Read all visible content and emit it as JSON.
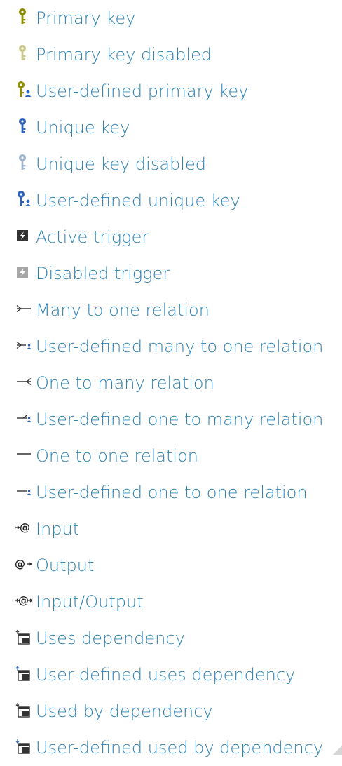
{
  "items": [
    {
      "label": "Primary key",
      "icon": "primary-key-icon"
    },
    {
      "label": "Primary key disabled",
      "icon": "primary-key-disabled-icon"
    },
    {
      "label": "User-defined primary key",
      "icon": "user-defined-primary-key-icon"
    },
    {
      "label": "Unique key",
      "icon": "unique-key-icon"
    },
    {
      "label": "Unique key disabled",
      "icon": "unique-key-disabled-icon"
    },
    {
      "label": "User-defined unique key",
      "icon": "user-defined-unique-key-icon"
    },
    {
      "label": "Active trigger",
      "icon": "active-trigger-icon"
    },
    {
      "label": "Disabled trigger",
      "icon": "disabled-trigger-icon"
    },
    {
      "label": "Many to one relation",
      "icon": "many-to-one-relation-icon"
    },
    {
      "label": "User-defined many to one relation",
      "icon": "user-defined-many-to-one-relation-icon"
    },
    {
      "label": "One to many relation",
      "icon": "one-to-many-relation-icon"
    },
    {
      "label": "User-defined one to many relation",
      "icon": "user-defined-one-to-many-relation-icon"
    },
    {
      "label": "One to one relation",
      "icon": "one-to-one-relation-icon"
    },
    {
      "label": "User-defined one to one relation",
      "icon": "user-defined-one-to-one-relation-icon"
    },
    {
      "label": "Input",
      "icon": "input-icon"
    },
    {
      "label": "Output",
      "icon": "output-icon"
    },
    {
      "label": "Input/Output",
      "icon": "input-output-icon"
    },
    {
      "label": "Uses dependency",
      "icon": "uses-dependency-icon"
    },
    {
      "label": "User-defined uses dependency",
      "icon": "user-defined-uses-dependency-icon"
    },
    {
      "label": "Used by dependency",
      "icon": "used-by-dependency-icon"
    },
    {
      "label": "User-defined used by dependency",
      "icon": "user-defined-used-by-dependency-icon"
    }
  ],
  "colors": {
    "label_text": "#2f84b5",
    "key_gold": "#8e8e00",
    "key_gold_disabled": "#c8c88a",
    "key_blue": "#2a63b8",
    "key_blue_disabled": "#9fb5cf",
    "user_badge": "#2a63b8",
    "trigger_active": "#333333",
    "trigger_disabled": "#a6a6a6",
    "relation_line": "#333333"
  }
}
